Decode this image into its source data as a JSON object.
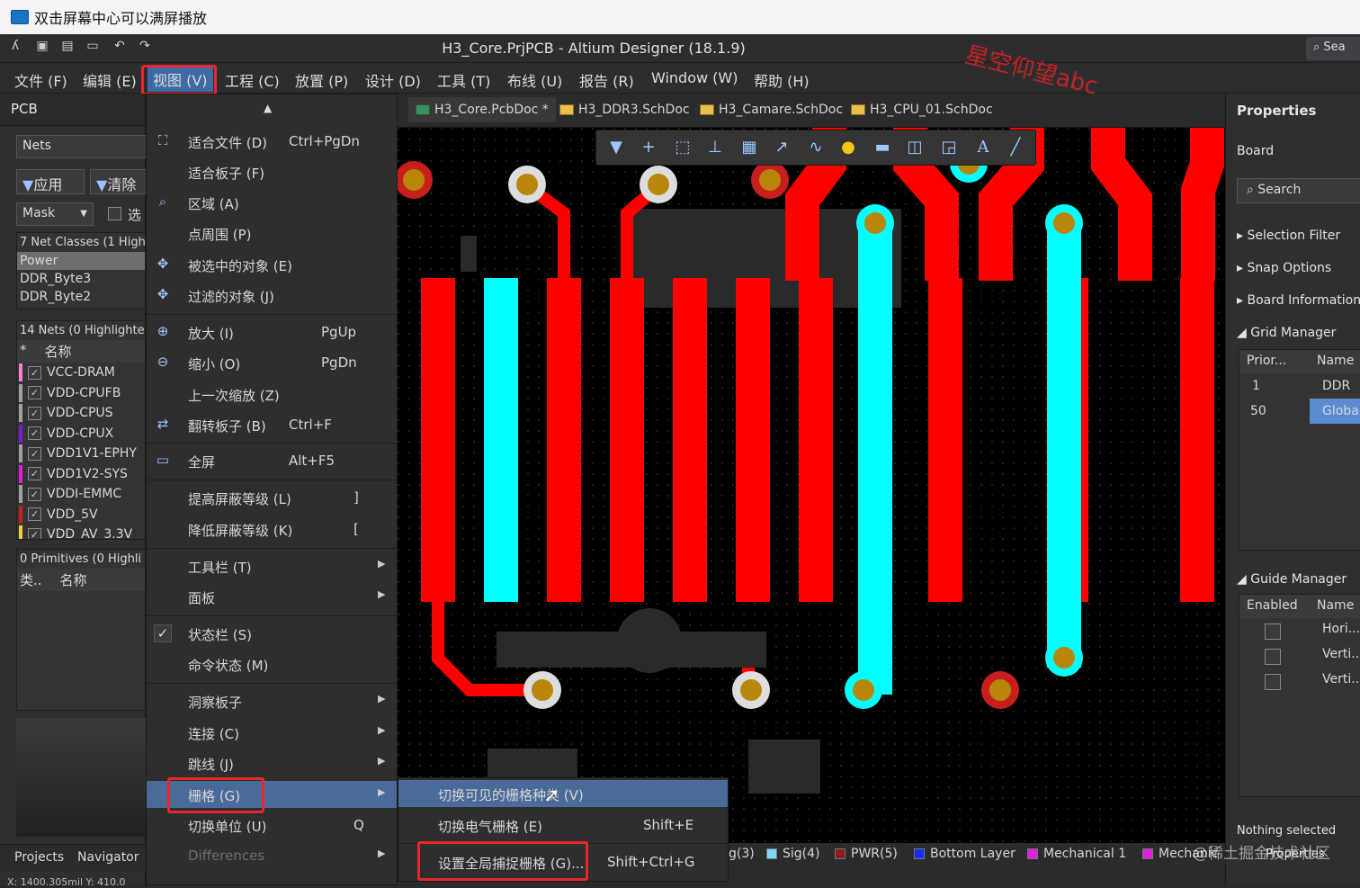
{
  "player": {
    "title": "双击屏幕中心可以满屏播放"
  },
  "app": {
    "title": "H3_Core.PrjPCB - Altium Designer (18.1.9)",
    "search": "Sea"
  },
  "menubar": [
    "文件 (F)",
    "编辑 (E)",
    "视图 (V)",
    "工程 (C)",
    "放置 (P)",
    "设计 (D)",
    "工具 (T)",
    "布线 (U)",
    "报告 (R)",
    "Window (W)",
    "帮助 (H)"
  ],
  "left_panel": {
    "title": "PCB",
    "dropdown": "Nets",
    "apply": "应用",
    "clear": "清除",
    "mask": "Mask",
    "select": "选",
    "classes_header": "7 Net Classes (1 High",
    "classes": [
      "Power",
      "DDR_Byte3",
      "DDR_Byte2"
    ],
    "nets_header": "14 Nets (0 Highlighte",
    "nets_col": "名称",
    "nets": [
      {
        "name": "VCC-DRAM",
        "color": "#ff7fd0"
      },
      {
        "name": "VDD-CPUFB",
        "color": "#a0a0a0"
      },
      {
        "name": "VDD-CPUS",
        "color": "#a0a0a0"
      },
      {
        "name": "VDD-CPUX",
        "color": "#7a1cc9"
      },
      {
        "name": "VDD1V1-EPHY",
        "color": "#a0a0a0"
      },
      {
        "name": "VDD1V2-SYS",
        "color": "#e020e0"
      },
      {
        "name": "VDDI-EMMC",
        "color": "#a0a0a0"
      },
      {
        "name": "VDD_5V",
        "color": "#c81e1e"
      },
      {
        "name": "VDD_AV_3.3V",
        "color": "#e8d23a"
      }
    ],
    "prims_header": "0 Primitives (0 Highli",
    "prims_col1": "类..",
    "prims_col2": "名称",
    "tab_projects": "Projects",
    "tab_navigator": "Navigator",
    "status": "X: 1400.305mil Y: 410.0"
  },
  "view_menu": {
    "items": [
      {
        "label": "适合文件 (D)",
        "shortcut": "Ctrl+PgDn",
        "icon": "fit-doc-icon"
      },
      {
        "label": "适合板子 (F)",
        "shortcut": "",
        "icon": ""
      },
      {
        "label": "区域 (A)",
        "shortcut": "",
        "icon": "area-icon"
      },
      {
        "label": "点周围 (P)",
        "shortcut": "",
        "icon": ""
      },
      {
        "label": "被选中的对象 (E)",
        "shortcut": "",
        "icon": "selected-objects-icon"
      },
      {
        "label": "过滤的对象 (J)",
        "shortcut": "",
        "icon": "filtered-objects-icon"
      },
      {
        "label": "放大 (I)",
        "shortcut": "PgUp",
        "icon": "zoom-in-icon"
      },
      {
        "label": "缩小 (O)",
        "shortcut": "PgDn",
        "icon": "zoom-out-icon"
      },
      {
        "label": "上一次缩放 (Z)",
        "shortcut": "",
        "icon": ""
      },
      {
        "label": "翻转板子 (B)",
        "shortcut": "Ctrl+F",
        "icon": "flip-board-icon"
      },
      {
        "label": "全屏",
        "shortcut": "Alt+F5",
        "icon": "fullscreen-icon"
      },
      {
        "label": "提高屏蔽等级 (L)",
        "shortcut": "]",
        "icon": ""
      },
      {
        "label": "降低屏蔽等级 (K)",
        "shortcut": "[",
        "icon": ""
      },
      {
        "label": "工具栏 (T)",
        "shortcut": "",
        "icon": ""
      },
      {
        "label": "面板",
        "shortcut": "",
        "icon": ""
      },
      {
        "label": "状态栏 (S)",
        "shortcut": "",
        "icon": "checkmark-icon"
      },
      {
        "label": "命令状态 (M)",
        "shortcut": "",
        "icon": ""
      },
      {
        "label": "洞察板子",
        "shortcut": "",
        "icon": ""
      },
      {
        "label": "连接 (C)",
        "shortcut": "",
        "icon": ""
      },
      {
        "label": "跳线 (J)",
        "shortcut": "",
        "icon": ""
      },
      {
        "label": "栅格 (G)",
        "shortcut": "",
        "icon": ""
      },
      {
        "label": "切换单位 (U)",
        "shortcut": "Q",
        "icon": ""
      },
      {
        "label": "Differences",
        "shortcut": "",
        "icon": ""
      }
    ]
  },
  "grid_submenu": [
    {
      "label": "切换可见的栅格种类 (V)",
      "shortcut": ""
    },
    {
      "label": "切换电气栅格 (E)",
      "shortcut": "Shift+E"
    },
    {
      "label": "设置全局捕捉栅格 (G)...",
      "shortcut": "Shift+Ctrl+G"
    }
  ],
  "doc_tabs": [
    "H3_Core.PcbDoc *",
    "H3_DDR3.SchDoc",
    "H3_Camare.SchDoc",
    "H3_CPU_01.SchDoc"
  ],
  "layers": [
    {
      "name": "g(3)",
      "color": ""
    },
    {
      "name": "Sig(4)",
      "color": "#7fd7ff"
    },
    {
      "name": "PWR(5)",
      "color": "#8b1a1a"
    },
    {
      "name": "Bottom Layer",
      "color": "#1a2bff"
    },
    {
      "name": "Mechanical 1",
      "color": "#e020e0"
    },
    {
      "name": "Mechanic",
      "color": "#e020e0"
    }
  ],
  "properties": {
    "title": "Properties",
    "board": "Board",
    "search": "Search",
    "sections": [
      "Selection Filter",
      "Snap Options",
      "Board Information"
    ],
    "grid_manager": "Grid Manager",
    "grid_cols": [
      "Prior...",
      "Name"
    ],
    "grid_rows": [
      [
        "1",
        "DDR"
      ],
      [
        "50",
        "Global"
      ]
    ],
    "guide_manager": "Guide Manager",
    "guide_cols": [
      "Enabled",
      "Name"
    ],
    "guide_rows": [
      "Hori...",
      "Verti...",
      "Verti..."
    ],
    "nothing": "Nothing selected",
    "tab": "Properties"
  },
  "watermark": "星空仰望abc",
  "watermark2": "@稀土掘金技术社区"
}
